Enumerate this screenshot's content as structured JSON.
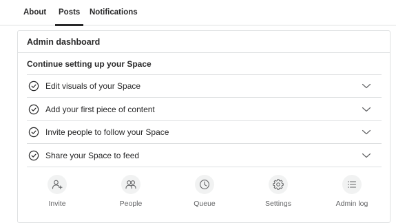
{
  "tabs": [
    {
      "label": "About",
      "active": false
    },
    {
      "label": "Posts",
      "active": true
    },
    {
      "label": "Notifications",
      "active": false
    }
  ],
  "card": {
    "title": "Admin dashboard",
    "section_title": "Continue setting up your Space",
    "steps": [
      {
        "label": "Edit visuals of your Space",
        "icon": "check-circle-icon",
        "toggle_icon": "chevron-down-icon"
      },
      {
        "label": "Add your first piece of content",
        "icon": "check-circle-icon",
        "toggle_icon": "chevron-down-icon"
      },
      {
        "label": "Invite people to follow your Space",
        "icon": "check-circle-icon",
        "toggle_icon": "chevron-down-icon"
      },
      {
        "label": "Share your Space to feed",
        "icon": "check-circle-icon",
        "toggle_icon": "chevron-down-icon"
      }
    ],
    "actions": [
      {
        "label": "Invite",
        "icon": "invite-person-icon"
      },
      {
        "label": "People",
        "icon": "people-icon"
      },
      {
        "label": "Queue",
        "icon": "clock-icon"
      },
      {
        "label": "Settings",
        "icon": "gear-icon"
      },
      {
        "label": "Admin log",
        "icon": "list-icon"
      }
    ]
  },
  "colors": {
    "text_primary": "#282829",
    "text_secondary": "#636466",
    "border": "#dee0e1",
    "icon_circle_bg": "#f1f2f2"
  }
}
